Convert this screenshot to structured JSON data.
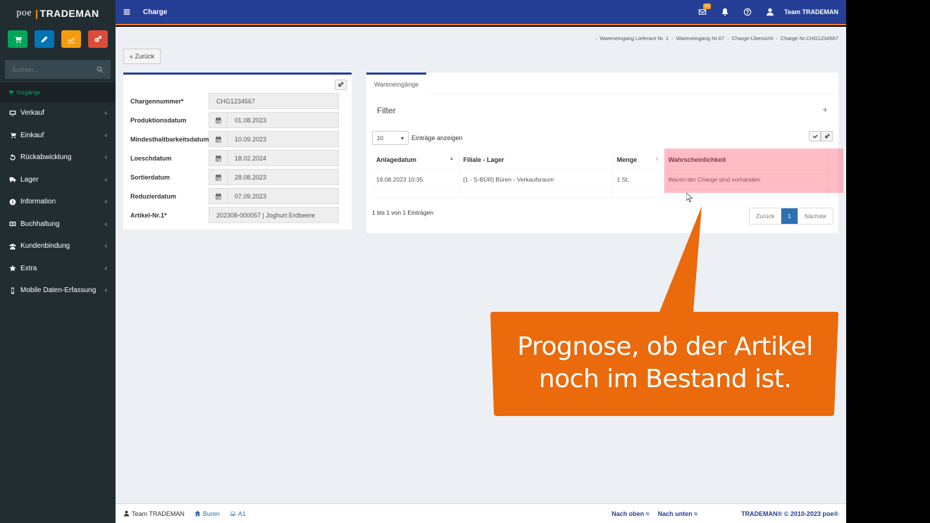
{
  "app": {
    "logo_poe": "poe",
    "logo_brand": "TRADEMAN",
    "page_title": "Charge",
    "user": "Team TRADEMAN",
    "mail_badge": "13"
  },
  "sidebar": {
    "search_placeholder": "Suchen...",
    "section": "Vorgänge",
    "items": [
      {
        "label": "Verkauf",
        "icon": "monitor-icon"
      },
      {
        "label": "Einkauf",
        "icon": "cart-icon"
      },
      {
        "label": "Rückabwicklung",
        "icon": "undo-icon"
      },
      {
        "label": "Lager",
        "icon": "truck-icon"
      },
      {
        "label": "Information",
        "icon": "info-icon"
      },
      {
        "label": "Buchhaltung",
        "icon": "money-icon"
      },
      {
        "label": "Kundenbindung",
        "icon": "users-icon"
      },
      {
        "label": "Extra",
        "icon": "star-icon"
      },
      {
        "label": "Mobile Daten-Erfassung",
        "icon": "mobile-icon"
      }
    ],
    "quick_colors": [
      "#00a65a",
      "#0073b7",
      "#f39c12",
      "#dd4b39"
    ]
  },
  "breadcrumb": [
    "Wareneingang Lieferant Nr. 1",
    "Wareneingang Nr.67",
    "Charge-Übersicht",
    "Charge Nr.CHG1234567"
  ],
  "back_label": "« Zurück",
  "form": {
    "fields": [
      {
        "label": "Chargennummer*",
        "value": "CHG1234567"
      },
      {
        "label": "Produktionsdatum",
        "value": "01.08.2023"
      },
      {
        "label": "Mindesthaltbarkeitsdatum",
        "value": "10.09.2023"
      },
      {
        "label": "Loeschdatum",
        "value": "18.02.2024"
      },
      {
        "label": "Sortierdatum",
        "value": "28.08.2023"
      },
      {
        "label": "Reduzierdatum",
        "value": "07.09.2023"
      },
      {
        "label": "Artikel-Nr.1*",
        "value": "202308-000057 | Joghurt Erdbeere"
      }
    ]
  },
  "panel": {
    "tab": "Wareneingänge",
    "filter": "Filter",
    "filter_plus": "+",
    "page_length": "10",
    "page_length_label": "Einträge anzeigen",
    "columns": [
      "Anlagedatum",
      "Filiale - Lager",
      "Menge",
      "Wahrscheinlichkeit"
    ],
    "rows": [
      [
        "18.08.2023 10:35",
        "[1 - S-BÜR] Büren - Verkaufsraum",
        "1 St.",
        "Waren der Charge sind vorhanden."
      ]
    ],
    "info": "1 bis 1 von 1 Einträgen",
    "pager": {
      "prev": "Zurück",
      "current": "1",
      "next": "Nächste"
    }
  },
  "callout": {
    "line1": "Prognose, ob der Artikel",
    "line2": "noch im Bestand ist.",
    "color": "#ea6a0c"
  },
  "footer": {
    "user": "Team TRADEMAN",
    "branch": "Buren",
    "terminal": "A1",
    "up": "Nach oben ≈",
    "down": "Nach unten ≈",
    "copyright": "TRADEMAN® © 2010-2023 poe®"
  }
}
